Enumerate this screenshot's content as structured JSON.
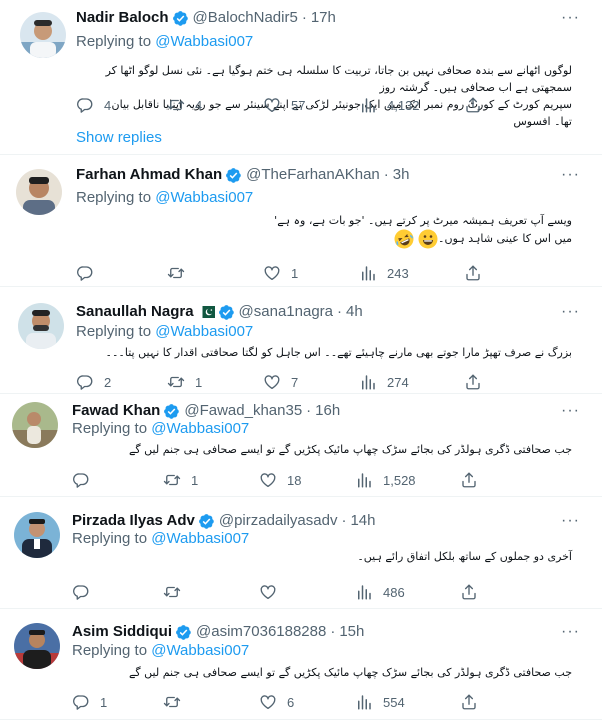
{
  "tweets": [
    {
      "name": "Nadir Baloch",
      "flag": false,
      "handle": "@BalochNadir5",
      "time": "17h",
      "replying_label": "Replying to",
      "replying_to": "@Wabbasi007",
      "lines": [
        "لوگوں اٹھانے سے بندہ صحافی نہیں بن جاتا، تربیت کا سلسلہ ہی ختم ہوگیا ہے۔ نئی نسل لوگو اٹھا کر سمجھتی ہے اب صحافی ہیں۔ گرشتہ روز",
        "سپریم کورٹ کے کورٹ روم نمبر ایک میں ایک جونیئر لڑکی نے اپنے سینئر سے جو رویہ اپنایا ناقابل بیان تھا۔ افسوس"
      ],
      "emojis": [],
      "replies": "4",
      "retweets": "4",
      "likes": "57",
      "views": "4,132"
    },
    {
      "name": "Farhan Ahmad Khan",
      "flag": false,
      "handle": "@TheFarhanAKhan",
      "time": "3h",
      "replying_label": "Replying to",
      "replying_to": "@Wabbasi007",
      "lines": [
        "ویسے آپ تعریف ہمیشہ میرٹ پر کرتے ہیں۔ 'جو بات ہے، وہ ہے'",
        "میں اس کا عینی شاہد ہوں۔"
      ],
      "emojis": [
        "grinning-face",
        "rolling-laughing-face"
      ],
      "replies": "",
      "retweets": "",
      "likes": "1",
      "views": "243"
    },
    {
      "name": "Sanaullah Nagra",
      "flag": true,
      "handle": "@sana1nagra",
      "time": "4h",
      "replying_label": "Replying to",
      "replying_to": "@Wabbasi007",
      "lines": [
        "بزرگ نے صرف تھپڑ مارا جوتے بھی مارنے چاہیئے تھے۔۔ اس جاہل کو لگتا صحافتی اقدار کا نہیں پتا۔۔۔"
      ],
      "emojis": [],
      "replies": "2",
      "retweets": "1",
      "likes": "7",
      "views": "274"
    },
    {
      "name": "Fawad Khan",
      "flag": false,
      "handle": "@Fawad_khan35",
      "time": "16h",
      "replying_label": "Replying to",
      "replying_to": "@Wabbasi007",
      "lines": [
        "جب صحافتی ڈگری ہولڈر کی بجائے سڑک چھاپ مائیک پکڑیں گے تو ایسے صحافی ہی جنم لیں گے"
      ],
      "emojis": [],
      "replies": "",
      "retweets": "1",
      "likes": "18",
      "views": "1,528"
    },
    {
      "name": "Pirzada Ilyas Adv",
      "flag": false,
      "handle": "@pirzadailyasadv",
      "time": "14h",
      "replying_label": "Replying to",
      "replying_to": "@Wabbasi007",
      "lines": [
        "آخری دو جملوں کے ساتھ بلکل اتفاق رائے ہیں۔"
      ],
      "emojis": [],
      "replies": "",
      "retweets": "",
      "likes": "",
      "views": "486"
    },
    {
      "name": "Asim Siddiqui",
      "flag": false,
      "handle": "@asim7036188288",
      "time": "15h",
      "replying_label": "Replying to",
      "replying_to": "@Wabbasi007",
      "lines": [
        "جب صحافتی ڈگری ہولڈر کی بجائے سڑک چھاپ مائیک پکڑیں گے تو ایسے صحافی ہی جنم لیں گے"
      ],
      "emojis": [],
      "replies": "1",
      "retweets": "",
      "likes": "6",
      "views": "554"
    }
  ],
  "show_replies": "Show replies",
  "colors": {
    "accent": "#1d9bf0",
    "secondary_text": "#536471",
    "verified_badge": "#1d9bf0",
    "divider": "#eff3f4"
  },
  "icons": [
    "verified-badge-icon",
    "pakistan-flag-icon",
    "more-icon",
    "reply-icon",
    "retweet-icon",
    "like-icon",
    "views-icon",
    "share-icon"
  ]
}
